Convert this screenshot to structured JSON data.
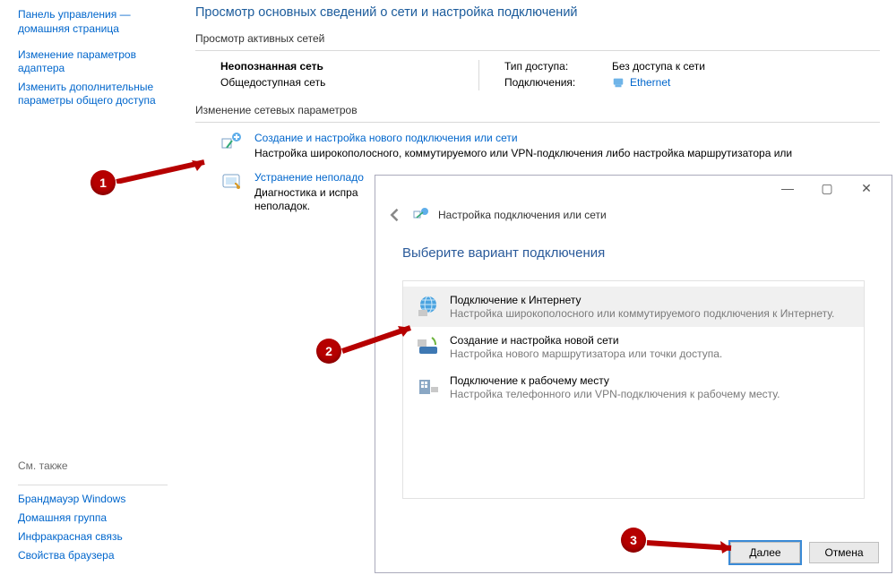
{
  "sidebar": {
    "home": "Панель управления — домашняя страница",
    "links": [
      "Изменение параметров адаптера",
      "Изменить дополнительные параметры общего доступа"
    ],
    "seeAlsoHeader": "См. также",
    "seeAlso": [
      "Брандмауэр Windows",
      "Домашняя группа",
      "Инфракрасная связь",
      "Свойства браузера"
    ]
  },
  "main": {
    "heading": "Просмотр основных сведений о сети и настройка подключений",
    "activeNetworksLabel": "Просмотр активных сетей",
    "network": {
      "name": "Неопознанная сеть",
      "type": "Общедоступная сеть",
      "accessKey": "Тип доступа:",
      "accessVal": "Без доступа к сети",
      "connKey": "Подключения:",
      "connVal": "Ethernet",
      "connIconName": "ethernet-icon"
    },
    "paramsLabel": "Изменение сетевых параметров",
    "tasks": [
      {
        "title": "Создание и настройка нового подключения или сети",
        "desc": "Настройка широкополосного, коммутируемого или VPN-подключения либо настройка маршрутизатора или",
        "iconName": "add-connection-icon"
      },
      {
        "title": "Устранение неполадо",
        "desc": "Диагностика и испра\nнеполадок.",
        "iconName": "troubleshoot-icon"
      }
    ]
  },
  "dialog": {
    "title": "Настройка подключения или сети",
    "headline": "Выберите вариант подключения",
    "options": [
      {
        "title": "Подключение к Интернету",
        "desc": "Настройка широкополосного или коммутируемого подключения к Интернету.",
        "iconName": "globe-icon",
        "selected": true
      },
      {
        "title": "Создание и настройка новой сети",
        "desc": "Настройка нового маршрутизатора или точки доступа.",
        "iconName": "router-icon",
        "selected": false
      },
      {
        "title": "Подключение к рабочему месту",
        "desc": "Настройка телефонного или VPN-подключения к рабочему месту.",
        "iconName": "workplace-icon",
        "selected": false
      }
    ],
    "buttons": {
      "next": "Далее",
      "cancel": "Отмена"
    }
  },
  "callouts": {
    "one": "1",
    "two": "2",
    "three": "3"
  }
}
